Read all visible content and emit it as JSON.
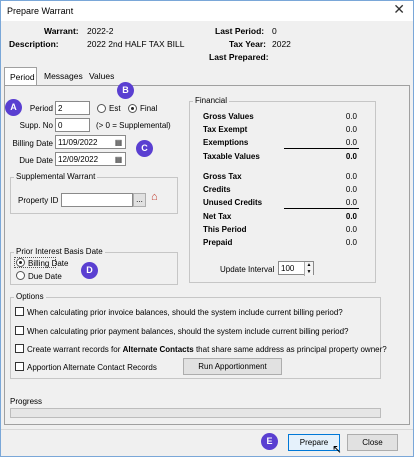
{
  "window": {
    "title": "Prepare Warrant"
  },
  "header": {
    "warrant_label": "Warrant:",
    "warrant_value": "2022-2",
    "description_label": "Description:",
    "description_value": "2022 2nd HALF TAX BILL",
    "last_period_label": "Last Period:",
    "last_period_value": "0",
    "tax_year_label": "Tax Year:",
    "tax_year_value": "2022",
    "last_prepared_label": "Last Prepared:",
    "last_prepared_value": ""
  },
  "tabs": [
    "Period",
    "Messages",
    "Values"
  ],
  "badges": {
    "a": "A",
    "b": "B",
    "c": "C",
    "d": "D",
    "e": "E"
  },
  "period": {
    "period_label": "Period",
    "period_value": "2",
    "est_label": "Est",
    "final_label": "Final",
    "selected_mode": "Final",
    "supp_label": "Supp. No",
    "supp_value": "0",
    "supp_hint": "(> 0 = Supplemental)",
    "billing_label": "Billing Date",
    "billing_value": "11/09/2022",
    "due_label": "Due Date",
    "due_value": "12/09/2022"
  },
  "supplemental": {
    "group_title": "Supplemental Warrant",
    "property_label": "Property ID",
    "property_value": "",
    "ellipsis_label": "..."
  },
  "prior_interest": {
    "group_title": "Prior Interest Basis Date",
    "billing_date_label": "Billing Date",
    "due_date_label": "Due Date",
    "selected": "Billing Date"
  },
  "financial": {
    "group_title": "Financial",
    "rows": [
      {
        "label": "Gross Values",
        "value": "0.0"
      },
      {
        "label": "Tax Exempt",
        "value": "0.0"
      },
      {
        "label": "Exemptions",
        "value": "0.0"
      },
      {
        "label": "Taxable Values",
        "value": "0.0"
      },
      {
        "label": "Gross Tax",
        "value": "0.0"
      },
      {
        "label": "Credits",
        "value": "0.0"
      },
      {
        "label": "Unused Credits",
        "value": "0.0"
      },
      {
        "label": "Net Tax",
        "value": "0.0"
      },
      {
        "label": "This Period",
        "value": "0.0"
      },
      {
        "label": "Prepaid",
        "value": "0.0"
      }
    ],
    "update_interval_label": "Update Interval",
    "update_interval_value": "100"
  },
  "options": {
    "group_title": "Options",
    "opt1": "When calculating prior invoice balances, should the system include current billing period?",
    "opt2": "When calculating prior payment balances, should the system include current billing period?",
    "opt3_pre": "Create warrant records for ",
    "opt3_bold": "Alternate Contacts",
    "opt3_post": " that share same address as principal property owner?",
    "opt4": "Apportion Alternate Contact Records",
    "run_button": "Run Apportionment"
  },
  "progress": {
    "label": "Progress",
    "value": 0
  },
  "footer": {
    "prepare_button": "Prepare",
    "close_button": "Close"
  },
  "colors": {
    "badge": "#5a3fd1",
    "focus_border": "#0078d7"
  }
}
